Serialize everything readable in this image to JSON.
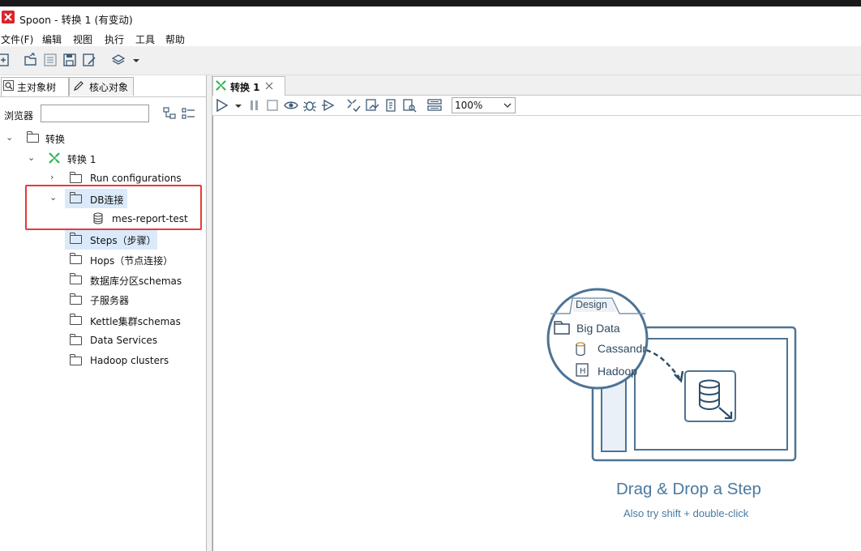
{
  "window": {
    "title": "Spoon - 转换 1 (有变动)"
  },
  "menu": [
    "文件(F)",
    "编辑",
    "视图",
    "执行",
    "工具",
    "帮助"
  ],
  "left_panel": {
    "tabs": [
      {
        "label": "主对象树",
        "icon": "search-icon"
      },
      {
        "label": "核心对象",
        "icon": "pencil-icon"
      }
    ],
    "browser_label": "浏览器",
    "search_value": "",
    "tree": [
      {
        "label": "转换",
        "icon": "folder-icon",
        "expanded": true
      },
      {
        "label": "转换 1",
        "icon": "transformation-icon",
        "expanded": true
      },
      {
        "label": "Run configurations",
        "icon": "folder-icon",
        "expanded": false
      },
      {
        "label": "DB连接",
        "icon": "folder-icon",
        "expanded": true,
        "selected": true
      },
      {
        "label": "mes-report-test",
        "icon": "database-icon"
      },
      {
        "label": "Steps（步骤）",
        "icon": "folder-icon"
      },
      {
        "label": "Hops（节点连接）",
        "icon": "folder-icon"
      },
      {
        "label": "数据库分区schemas",
        "icon": "folder-icon"
      },
      {
        "label": "子服务器",
        "icon": "folder-icon"
      },
      {
        "label": "Kettle集群schemas",
        "icon": "folder-icon"
      },
      {
        "label": "Data Services",
        "icon": "folder-icon"
      },
      {
        "label": "Hadoop clusters",
        "icon": "folder-icon"
      }
    ]
  },
  "canvas": {
    "tab_label": "转换 1",
    "zoom": "100%",
    "illustration": {
      "tab": "Design",
      "folder": "Big Data",
      "items": [
        "Cassandr",
        "Hadoop"
      ]
    },
    "drag_title": "Drag & Drop a Step",
    "drag_subtitle": "Also try shift + double-click"
  },
  "colors": {
    "accent": "#4a7aa0",
    "highlight_box": "#e53b3b",
    "selection": "#dbeafb",
    "brand": "#d9262b"
  }
}
